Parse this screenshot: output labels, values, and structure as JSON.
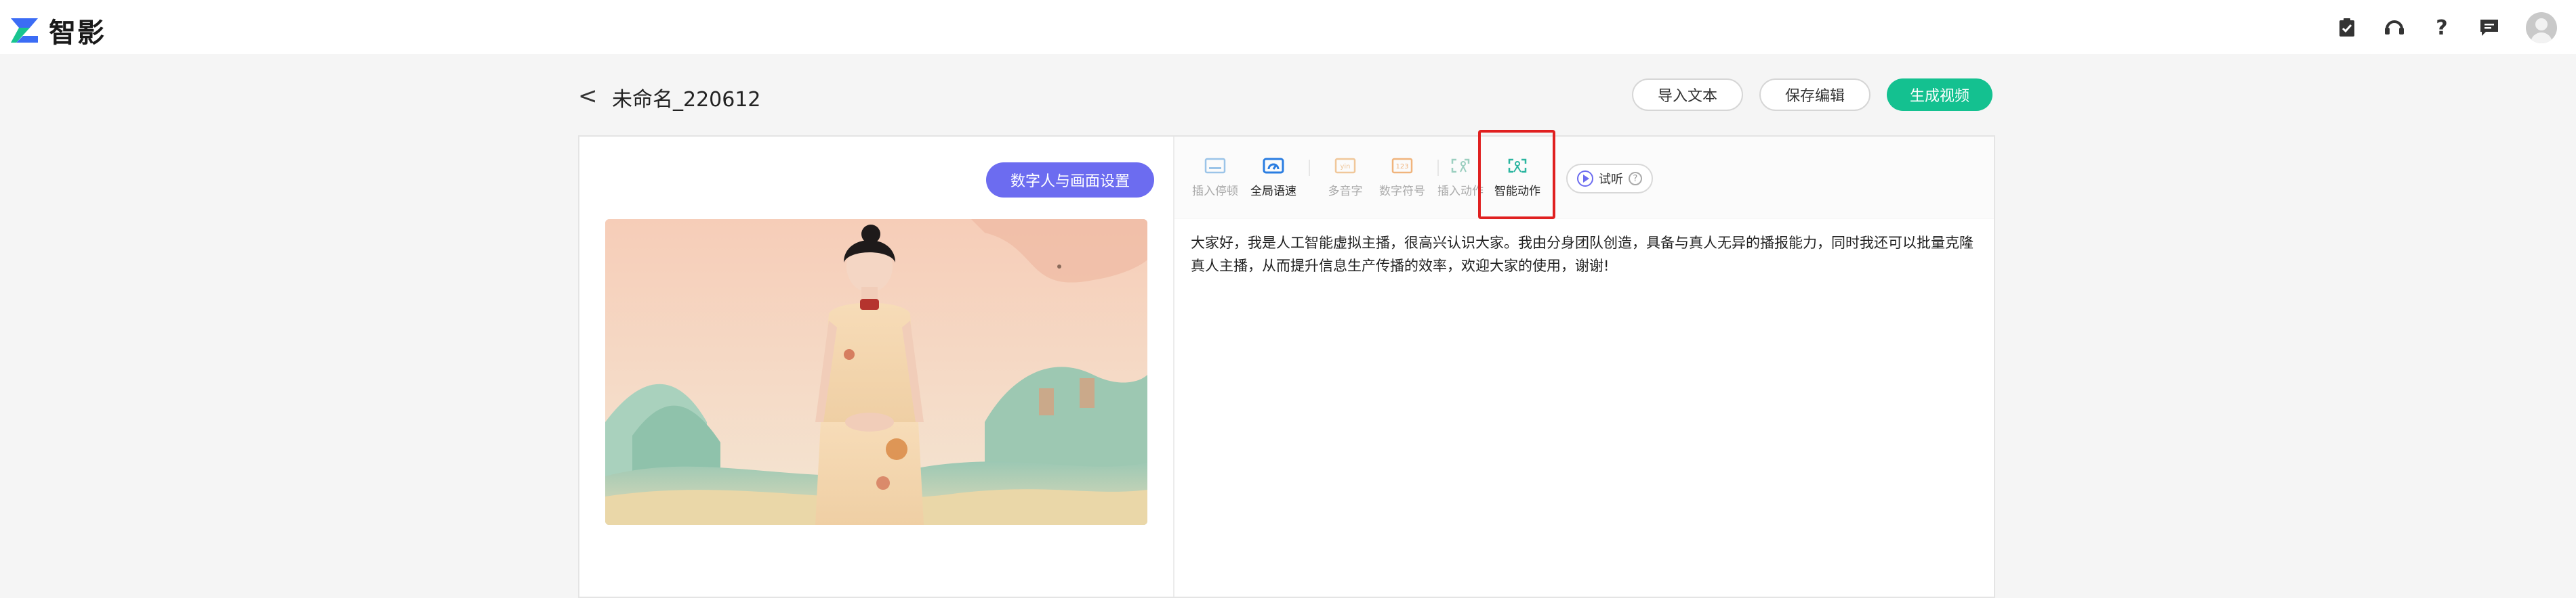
{
  "app": {
    "name": "智影"
  },
  "topbar": {
    "icons": [
      "clipboard-check-icon",
      "headset-icon",
      "help-icon",
      "message-icon",
      "avatar"
    ],
    "help_glyph": "?"
  },
  "header": {
    "back_glyph": "<",
    "title": "未命名_220612",
    "import_label": "导入文本",
    "save_label": "保存编辑",
    "generate_label": "生成视频"
  },
  "left_panel": {
    "settings_label": "数字人与画面设置"
  },
  "toolbar": {
    "items": [
      {
        "label": "插入停顿",
        "icon": "pause-insert-icon",
        "active": false
      },
      {
        "label": "全局语速",
        "icon": "speed-icon",
        "active": true
      },
      {
        "label": "多音字",
        "icon": "polyphone-icon",
        "active": false
      },
      {
        "label": "数字符号",
        "icon": "number-symbol-icon",
        "active": false
      },
      {
        "label": "插入动作",
        "icon": "insert-action-icon",
        "active": false
      },
      {
        "label": "智能动作",
        "icon": "smart-action-icon",
        "active": true
      }
    ],
    "audition_label": "试听",
    "help_glyph": "?"
  },
  "script": {
    "text": "大家好，我是人工智能虚拟主播，很高兴认识大家。我由分身团队创造，具备与真人无异的播报能力，同时我还可以批量克隆真人主播，从而提升信息生产传播的效率，欢迎大家的使用，谢谢!"
  },
  "colors": {
    "accent": "#14c190",
    "purple": "#6c6cf0",
    "highlight": "#e02020"
  }
}
